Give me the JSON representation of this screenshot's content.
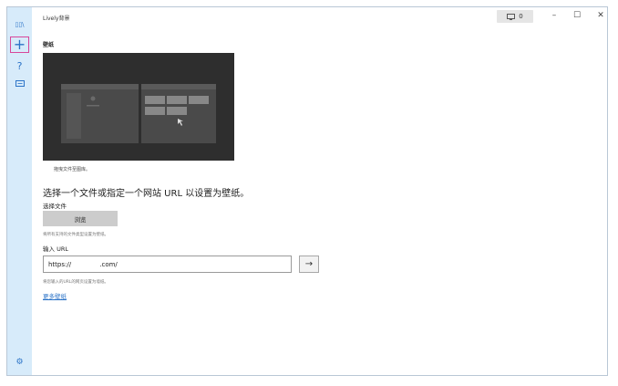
{
  "app": {
    "title": "Lively背景"
  },
  "titlebar": {
    "monitor_count": "0",
    "minimize": "–",
    "maximize": "☐",
    "close": "✕"
  },
  "sidebar": {
    "items": [
      {
        "name": "library",
        "glyph": "▯▯\\"
      },
      {
        "name": "add",
        "glyph": "+"
      },
      {
        "name": "help",
        "glyph": "?"
      },
      {
        "name": "feedback",
        "glyph": "▭"
      }
    ],
    "settings_glyph": "⚙"
  },
  "main": {
    "section_title": "壁纸",
    "preview_caption": "拖曳文件至图库。",
    "heading": "选择一个文件或指定一个网站 URL 以设置为壁纸。",
    "file_label": "选择文件",
    "browse_label": "浏览",
    "file_hint": "将所有支持的文件类型设置为壁纸。",
    "url_label": "输入 URL",
    "url_value": "https://              .com/",
    "url_hint": "将您输入的URL的网页设置为墙纸。",
    "go_arrow": "→",
    "more_link": "更多壁纸"
  },
  "colors": {
    "accent": "#2b73c7",
    "sidebar": "#d7ebfa",
    "selection": "#d8479a"
  }
}
